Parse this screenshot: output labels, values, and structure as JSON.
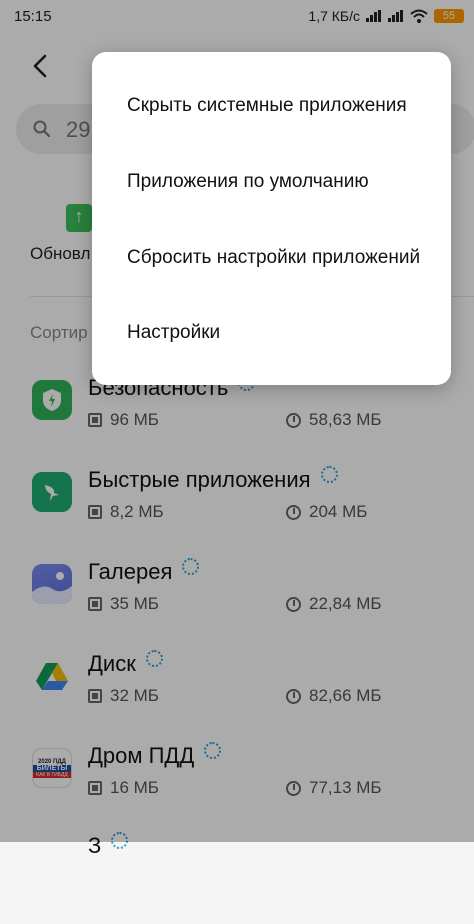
{
  "status_bar": {
    "time": "15:15",
    "network_speed": "1,7 КБ/с",
    "battery": "55"
  },
  "header": {
    "back_icon": "back-arrow-icon"
  },
  "search": {
    "icon": "search-icon",
    "value": "29"
  },
  "update_section": {
    "icon": "update-arrow-icon",
    "label": "Обновл"
  },
  "sort_label": "Сортир",
  "apps": [
    {
      "name": "Безопасность",
      "icon": "security-icon",
      "icon_color": "#31b35a",
      "ram": "96 МБ",
      "storage": "58,63 МБ"
    },
    {
      "name": "Быстрые приложения",
      "icon": "quick-apps-icon",
      "icon_color": "#1fae74",
      "ram": "8,2 МБ",
      "storage": "204 МБ"
    },
    {
      "name": "Галерея",
      "icon": "gallery-icon",
      "icon_color": "#6e7fe8",
      "ram": "35 МБ",
      "storage": "22,84 МБ"
    },
    {
      "name": "Диск",
      "icon": "google-drive-icon",
      "icon_color": "#ffffff",
      "ram": "32 МБ",
      "storage": "82,66 МБ"
    },
    {
      "name": "Дром ПДД",
      "icon": "drom-pdd-icon",
      "icon_color": "#ffffff",
      "ram": "16 МБ",
      "storage": "77,13 МБ",
      "icon_texts": [
        "2020 ПДД",
        "БИЛЕТЫ",
        "КАК В ГИБДД"
      ]
    },
    {
      "name": "З",
      "icon": "app-icon",
      "icon_color": "#dddddd"
    }
  ],
  "menu": {
    "items": [
      "Скрыть системные приложения",
      "Приложения по умолчанию",
      "Сбросить настройки приложений",
      "Настройки"
    ]
  },
  "colors": {
    "scrim": "rgba(0,0,0,0.33)",
    "accent_loading": "#2f9bd9",
    "battery": "#ff9800"
  }
}
